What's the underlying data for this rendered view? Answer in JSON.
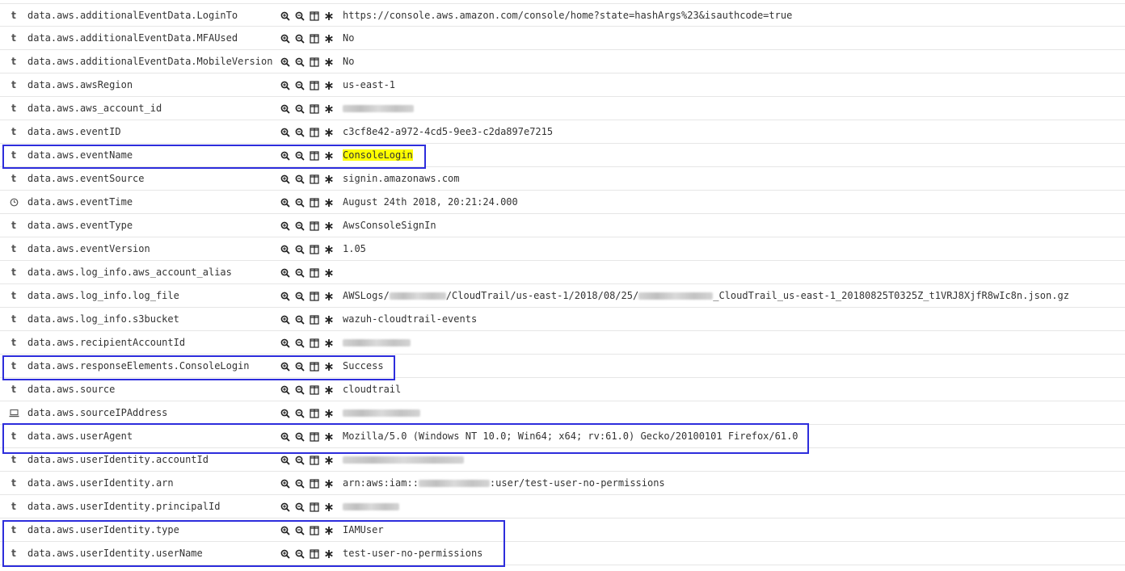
{
  "accent_box_color": "#2d2ddc",
  "highlight_color": "#ffff00",
  "row_actions": [
    "filter-for-value-icon",
    "filter-out-value-icon",
    "toggle-column-icon",
    "filter-for-field-present-icon"
  ],
  "rows": [
    {
      "type": "t",
      "type_icon": "string-type-icon",
      "field": "data.aws.additionalEventData.LoginTo",
      "value": "https://console.aws.amazon.com/console/home?state=hashArgs%23&isauthcode=true"
    },
    {
      "type": "t",
      "type_icon": "string-type-icon",
      "field": "data.aws.additionalEventData.MFAUsed",
      "value": "No"
    },
    {
      "type": "t",
      "type_icon": "string-type-icon",
      "field": "data.aws.additionalEventData.MobileVersion",
      "value": "No"
    },
    {
      "type": "t",
      "type_icon": "string-type-icon",
      "field": "data.aws.awsRegion",
      "value": "us-east-1"
    },
    {
      "type": "t",
      "type_icon": "string-type-icon",
      "field": "data.aws.aws_account_id",
      "value": "[blurred]"
    },
    {
      "type": "t",
      "type_icon": "string-type-icon",
      "field": "data.aws.eventID",
      "value": "c3cf8e42-a972-4cd5-9ee3-c2da897e7215"
    },
    {
      "type": "t",
      "type_icon": "string-type-icon",
      "field": "data.aws.eventName",
      "value": "ConsoleLogin",
      "highlight": true
    },
    {
      "type": "t",
      "type_icon": "string-type-icon",
      "field": "data.aws.eventSource",
      "value": "signin.amazonaws.com"
    },
    {
      "type": "",
      "type_icon": "clock-icon",
      "field": "data.aws.eventTime",
      "value": "August 24th 2018, 20:21:24.000"
    },
    {
      "type": "t",
      "type_icon": "string-type-icon",
      "field": "data.aws.eventType",
      "value": "AwsConsoleSignIn"
    },
    {
      "type": "t",
      "type_icon": "string-type-icon",
      "field": "data.aws.eventVersion",
      "value": "1.05"
    },
    {
      "type": "t",
      "type_icon": "string-type-icon",
      "field": "data.aws.log_info.aws_account_alias",
      "value": ""
    },
    {
      "type": "t",
      "type_icon": "string-type-icon",
      "field": "data.aws.log_info.log_file",
      "value_parts": [
        "AWSLogs/",
        "[blurred]",
        "/CloudTrail/us-east-1/2018/08/25/",
        "[blurred]",
        "_CloudTrail_us-east-1_20180825T0325Z_t1VRJ8XjfR8wIc8n.json.gz"
      ]
    },
    {
      "type": "t",
      "type_icon": "string-type-icon",
      "field": "data.aws.log_info.s3bucket",
      "value": "wazuh-cloudtrail-events"
    },
    {
      "type": "t",
      "type_icon": "string-type-icon",
      "field": "data.aws.recipientAccountId",
      "value": "[blurred]"
    },
    {
      "type": "t",
      "type_icon": "string-type-icon",
      "field": "data.aws.responseElements.ConsoleLogin",
      "value": "Success"
    },
    {
      "type": "t",
      "type_icon": "string-type-icon",
      "field": "data.aws.source",
      "value": "cloudtrail"
    },
    {
      "type": "",
      "type_icon": "ip-address-icon",
      "field": "data.aws.sourceIPAddress",
      "value": "[blurred]"
    },
    {
      "type": "t",
      "type_icon": "string-type-icon",
      "field": "data.aws.userAgent",
      "value": "Mozilla/5.0 (Windows NT 10.0; Win64; x64; rv:61.0) Gecko/20100101 Firefox/61.0"
    },
    {
      "type": "t",
      "type_icon": "string-type-icon",
      "field": "data.aws.userIdentity.accountId",
      "value": "[blurred]"
    },
    {
      "type": "t",
      "type_icon": "string-type-icon",
      "field": "data.aws.userIdentity.arn",
      "value_parts": [
        "arn:aws:iam::",
        "[blurred]",
        ":user/test-user-no-permissions"
      ]
    },
    {
      "type": "t",
      "type_icon": "string-type-icon",
      "field": "data.aws.userIdentity.principalId",
      "value": "[blurred]"
    },
    {
      "type": "t",
      "type_icon": "string-type-icon",
      "field": "data.aws.userIdentity.type",
      "value": "IAMUser"
    },
    {
      "type": "t",
      "type_icon": "string-type-icon",
      "field": "data.aws.userIdentity.userName",
      "value": "test-user-no-permissions"
    }
  ]
}
